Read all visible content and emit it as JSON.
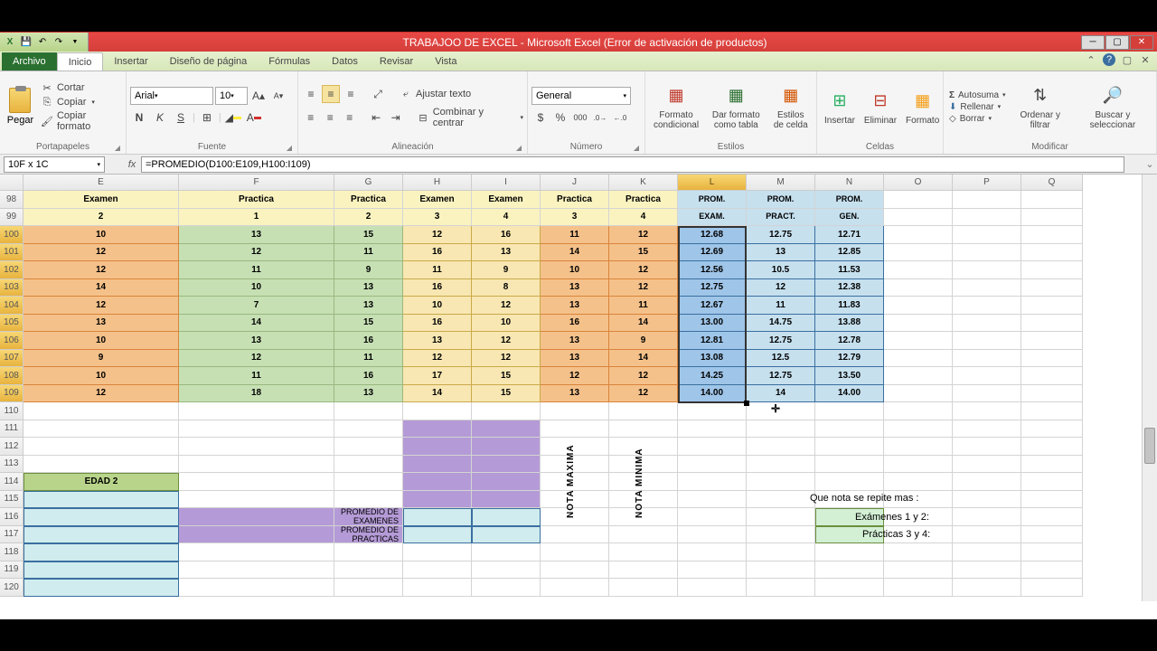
{
  "title": "TRABAJOO DE EXCEL - Microsoft Excel (Error de activación de productos)",
  "tabs": {
    "file": "Archivo",
    "items": [
      "Inicio",
      "Insertar",
      "Diseño de página",
      "Fórmulas",
      "Datos",
      "Revisar",
      "Vista"
    ]
  },
  "clipboard": {
    "paste": "Pegar",
    "cut": "Cortar",
    "copy": "Copiar",
    "format": "Copiar formato",
    "label": "Portapapeles"
  },
  "font": {
    "name": "Arial",
    "size": "10",
    "label": "Fuente"
  },
  "align": {
    "wrap": "Ajustar texto",
    "merge": "Combinar y centrar",
    "label": "Alineación"
  },
  "number": {
    "format": "General",
    "label": "Número"
  },
  "styles": {
    "cond": "Formato condicional",
    "table": "Dar formato como tabla",
    "cell": "Estilos de celda",
    "label": "Estilos"
  },
  "cells": {
    "insert": "Insertar",
    "delete": "Eliminar",
    "format": "Formato",
    "label": "Celdas"
  },
  "editing": {
    "sum": "Autosuma",
    "fill": "Rellenar",
    "clear": "Borrar",
    "sort": "Ordenar y filtrar",
    "find": "Buscar y seleccionar",
    "label": "Modificar"
  },
  "namebox": "10F x 1C",
  "formula": "=PROMEDIO(D100:E109,H100:I109)",
  "cols": [
    "E",
    "F",
    "G",
    "H",
    "I",
    "J",
    "K",
    "L",
    "M",
    "N",
    "O",
    "P",
    "Q"
  ],
  "row_nums": [
    "98",
    "99",
    "100",
    "101",
    "102",
    "103",
    "104",
    "105",
    "106",
    "107",
    "108",
    "109",
    "110",
    "111",
    "112",
    "113",
    "114",
    "115",
    "116",
    "117",
    "118",
    "119",
    "120"
  ],
  "header1": {
    "E": "Examen",
    "F": "Practica",
    "G": "Practica",
    "H": "Examen",
    "I": "Examen",
    "J": "Practica",
    "K": "Practica",
    "L": "PROM.",
    "M": "PROM.",
    "N": "PROM."
  },
  "header2": {
    "E": "2",
    "F": "1",
    "G": "2",
    "H": "3",
    "I": "4",
    "J": "3",
    "K": "4",
    "L": "EXAM.",
    "M": "PRACT.",
    "N": "GEN."
  },
  "rows": [
    {
      "E": "10",
      "F": "13",
      "G": "15",
      "H": "12",
      "I": "16",
      "J": "11",
      "K": "12",
      "L": "12.68",
      "M": "12.75",
      "N": "12.71"
    },
    {
      "E": "12",
      "F": "12",
      "G": "11",
      "H": "16",
      "I": "13",
      "J": "14",
      "K": "15",
      "L": "12.69",
      "M": "13",
      "N": "12.85"
    },
    {
      "E": "12",
      "F": "11",
      "G": "9",
      "H": "11",
      "I": "9",
      "J": "10",
      "K": "12",
      "L": "12.56",
      "M": "10.5",
      "N": "11.53"
    },
    {
      "E": "14",
      "F": "10",
      "G": "13",
      "H": "16",
      "I": "8",
      "J": "13",
      "K": "12",
      "L": "12.75",
      "M": "12",
      "N": "12.38"
    },
    {
      "E": "12",
      "F": "7",
      "G": "13",
      "H": "10",
      "I": "12",
      "J": "13",
      "K": "11",
      "L": "12.67",
      "M": "11",
      "N": "11.83"
    },
    {
      "E": "13",
      "F": "14",
      "G": "15",
      "H": "16",
      "I": "10",
      "J": "16",
      "K": "14",
      "L": "13.00",
      "M": "14.75",
      "N": "13.88"
    },
    {
      "E": "10",
      "F": "13",
      "G": "16",
      "H": "13",
      "I": "12",
      "J": "13",
      "K": "9",
      "L": "12.81",
      "M": "12.75",
      "N": "12.78"
    },
    {
      "E": "9",
      "F": "12",
      "G": "11",
      "H": "12",
      "I": "12",
      "J": "13",
      "K": "14",
      "L": "13.08",
      "M": "12.5",
      "N": "12.79"
    },
    {
      "E": "10",
      "F": "11",
      "G": "16",
      "H": "17",
      "I": "15",
      "J": "12",
      "K": "12",
      "L": "14.25",
      "M": "12.75",
      "N": "13.50"
    },
    {
      "E": "12",
      "F": "18",
      "G": "13",
      "H": "14",
      "I": "15",
      "J": "13",
      "K": "12",
      "L": "14.00",
      "M": "14",
      "N": "14.00"
    }
  ],
  "lower": {
    "edad": "EDAD 2",
    "nota_max": "NOTA MAXIMA",
    "nota_min": "NOTA MINIMA",
    "prom_ex": "PROMEDIO DE EXAMENES",
    "prom_pr": "PROMEDIO DE PRACTICAS",
    "question": "Que nota se repite mas :",
    "ex12": "Exámenes 1 y 2:",
    "pr34": "Prácticas 3 y 4:"
  }
}
